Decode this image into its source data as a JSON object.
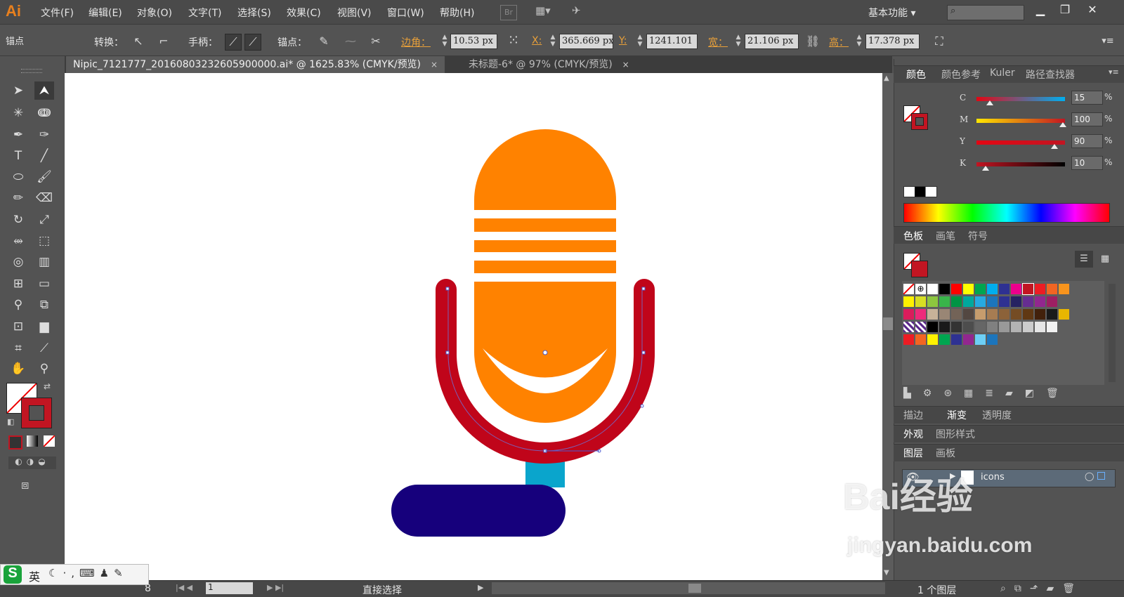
{
  "app": {
    "logo": "Ai"
  },
  "menu": [
    "文件(F)",
    "编辑(E)",
    "对象(O)",
    "文字(T)",
    "选择(S)",
    "效果(C)",
    "视图(V)",
    "窗口(W)",
    "帮助(H)"
  ],
  "bridge_label": "Br",
  "workspace": "基本功能",
  "control": {
    "mode_label": "锚点",
    "convert_label": "转换：",
    "handle_label": "手柄：",
    "anchor_label": "锚点：",
    "corner_label": "边角：",
    "corner_value": "10.53 px",
    "x_label": "X:",
    "x_value": "365.669 px",
    "y_label": "Y:",
    "y_value": "1241.101",
    "w_label": "宽：",
    "w_value": "21.106 px",
    "h_label": "高：",
    "h_value": "17.378 px"
  },
  "tabs": [
    {
      "title": "Nipic_7121777_20160803232605900000.ai* @ 1625.83% (CMYK/预览)",
      "close": "×"
    },
    {
      "title": "未标题-6* @ 97% (CMYK/预览)",
      "close": "×"
    }
  ],
  "color_panel": {
    "tabs": [
      "颜色",
      "颜色参考",
      "Kuler",
      "路径查找器"
    ],
    "channels": [
      {
        "label": "C",
        "value": "15",
        "unit": "%",
        "fraction": 0.15
      },
      {
        "label": "M",
        "value": "100",
        "unit": "%",
        "fraction": 1.0
      },
      {
        "label": "Y",
        "value": "90",
        "unit": "%",
        "fraction": 0.9
      },
      {
        "label": "K",
        "value": "10",
        "unit": "%",
        "fraction": 0.1
      }
    ]
  },
  "swatch_panel": {
    "tabs": [
      "色板",
      "画笔",
      "符号"
    ]
  },
  "stroke_panel": {
    "tabs": [
      "描边",
      "渐变",
      "透明度"
    ]
  },
  "appearance_panel": {
    "tabs": [
      "外观",
      "图形样式"
    ]
  },
  "layers_panel": {
    "tabs": [
      "图层",
      "画板"
    ],
    "layers": [
      {
        "name": "icons"
      }
    ],
    "count": "1 个图层"
  },
  "status": {
    "zoom": "8",
    "page": "1",
    "tool": "直接选择"
  },
  "ime": {
    "lang": "英"
  },
  "watermark": {
    "line1": "Bai经验",
    "line2": "jingyan.baidu.com"
  },
  "colors": {
    "mic_head": "#ff8200",
    "mic_holder": "#c0051a",
    "mic_stem": "#0aa5cc",
    "mic_base": "#16007c",
    "accent": "#e8801e",
    "stroke_swatch": "#c21522"
  },
  "swatches": [
    [
      "none",
      "reg",
      "#ffffff",
      "#000000",
      "#ff0000",
      "#ffff00",
      "#00a650",
      "#00aeef",
      "#2e3192",
      "#ec008c",
      "#c21522",
      "#ed1c24",
      "#f26522",
      "#f7941d"
    ],
    [
      "#fff200",
      "#d7df23",
      "#8dc63f",
      "#39b54a",
      "#009444",
      "#00a99d",
      "#27aae1",
      "#1c75bc",
      "#2e3192",
      "#262262",
      "#662d91",
      "#92278f",
      "#9e1f63"
    ],
    [
      "#da1c5c",
      "#ee2a7b",
      "#c7b299",
      "#998675",
      "#736357",
      "#534741",
      "#c69c6d",
      "#a67c52",
      "#8c6239",
      "#754c24",
      "#603813",
      "#42210b",
      "#1a1a1a",
      "#e8b600"
    ],
    [
      "pattern",
      "pattern2",
      "#000000",
      "#1a1a1a",
      "#333333",
      "#4d4d4d",
      "#666666",
      "#808080",
      "#999999",
      "#b3b3b3",
      "#cccccc",
      "#e6e6e6",
      "#f2f2f2"
    ],
    [
      "#ed1c24",
      "#f26522",
      "#fff200",
      "#00a650",
      "#2e3192",
      "#92278f",
      "#6dcff6",
      "#1c75bc"
    ]
  ]
}
